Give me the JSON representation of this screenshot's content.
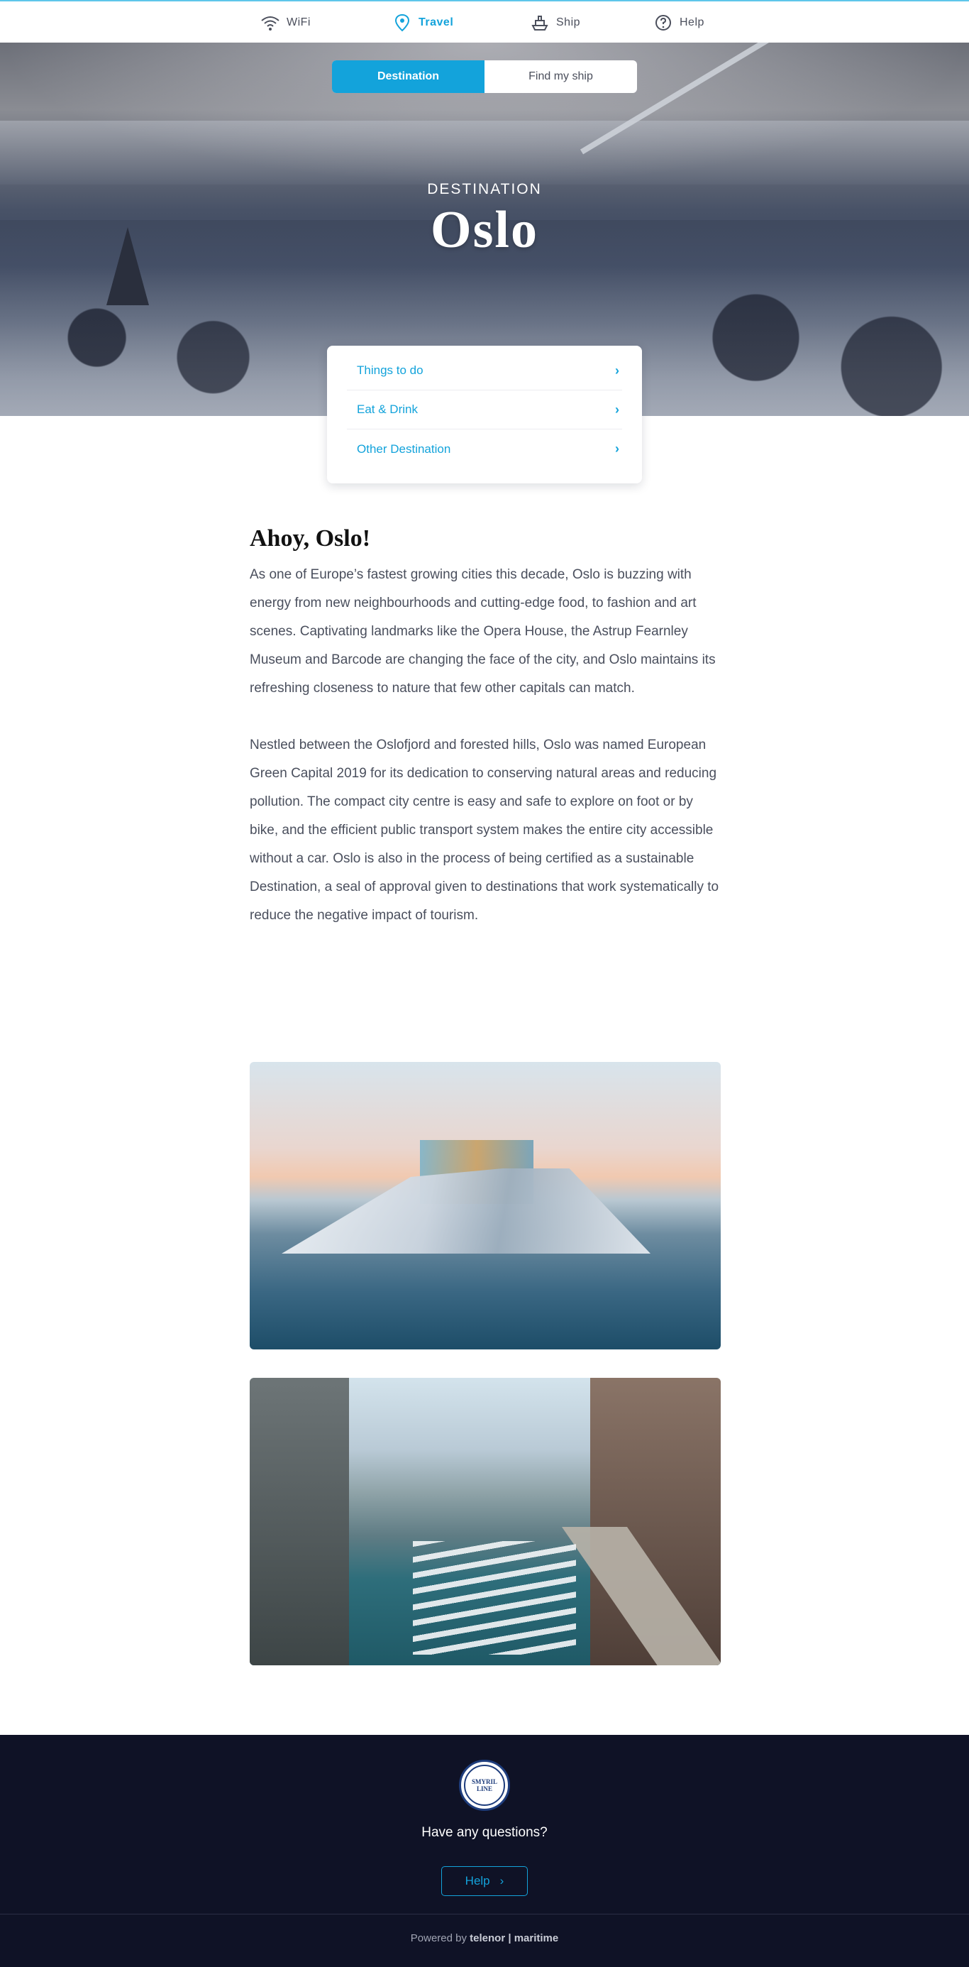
{
  "nav": {
    "items": [
      {
        "label": "WiFi",
        "icon": "wifi-icon"
      },
      {
        "label": "Travel",
        "icon": "location-pin-icon"
      },
      {
        "label": "Ship",
        "icon": "ship-icon"
      },
      {
        "label": "Help",
        "icon": "question-icon"
      }
    ],
    "active": "Travel",
    "accent_color": "#13a3db"
  },
  "hero": {
    "tabs": [
      "Destination",
      "Find my ship"
    ],
    "active_tab": "Destination",
    "eyebrow": "DESTINATION",
    "title": "Oslo"
  },
  "links": [
    {
      "label": "Things to do",
      "icon": "chevron-right-icon"
    },
    {
      "label": "Eat & Drink",
      "icon": "chevron-right-icon"
    },
    {
      "label": "Other Destination",
      "icon": "chevron-right-icon"
    }
  ],
  "article": {
    "heading": "Ahoy, Oslo!",
    "paragraphs": [
      "As one of Europe’s fastest growing cities this decade, Oslo is buzzing with energy from new neighbourhoods and cutting-edge food, to fashion and art scenes. Captivating landmarks like the Opera House, the Astrup Fearnley Museum and Barcode are changing the face of the city, and Oslo maintains its refreshing closeness to nature that few other capitals can match.",
      "Nestled between the Oslofjord and forested hills, Oslo was named European Green Capital 2019 for its dedication to conserving natural areas and reducing pollution. The compact city centre is easy and safe to explore on foot or by bike, and the efficient public transport system makes the entire city accessible without a car. Oslo is also in the process of being certified as a sustainable Destination, a seal of approval given to destinations that work systematically to reduce the negative impact of tourism."
    ]
  },
  "footer": {
    "logo_text": "SMYRIL LINE",
    "question": "Have any questions?",
    "help_label": "Help",
    "powered_prefix": "Powered by",
    "powered_brand": "telenor | maritime",
    "background": "#0f1226"
  }
}
